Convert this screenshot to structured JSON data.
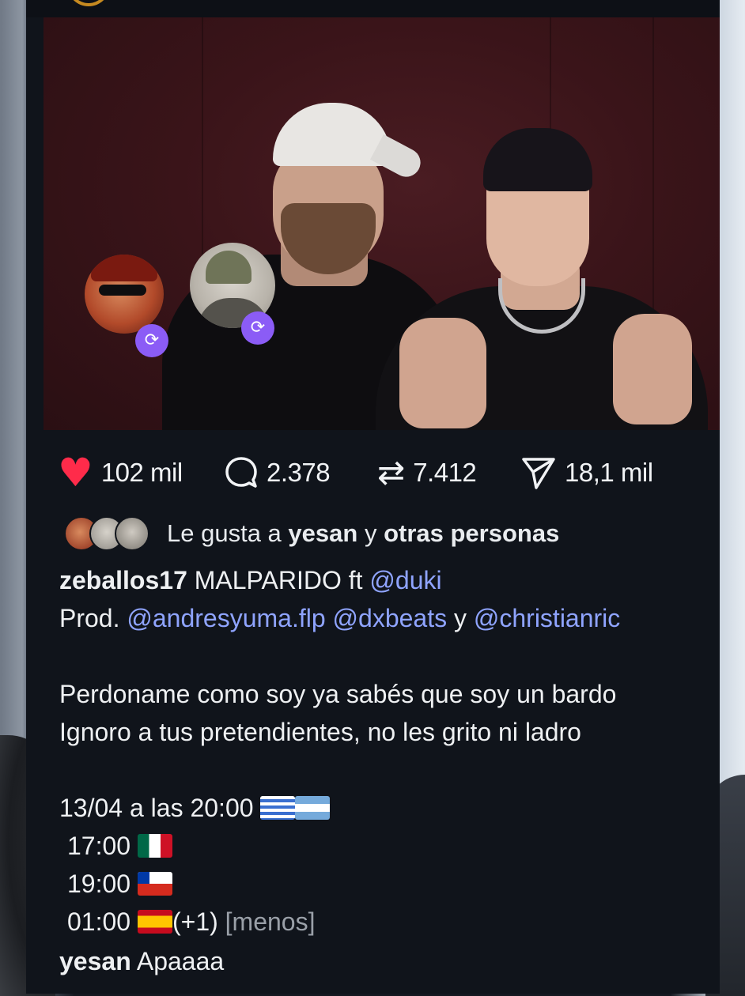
{
  "post": {
    "author": "zeballos17",
    "repost_badge_icon": "repost-icon",
    "stats": {
      "likes": "102 mil",
      "comments": "2.378",
      "reposts": "7.412",
      "shares": "18,1 mil"
    },
    "liked_by": {
      "prefix": "Le gusta a",
      "user": "yesan",
      "connector": "y",
      "others": "otras personas"
    },
    "caption": {
      "title": "MALPARIDO ft",
      "mention_duki": "@duki",
      "prod_label": "Prod.",
      "mention_andresyuma": "@andresyuma.flp",
      "mention_dxbeats": "@dxbeats",
      "and_word": "y",
      "mention_christian": "@christianric",
      "lyric_line_1": "Perdoname como soy ya sabés que soy un bardo",
      "lyric_line_2": "Ignoro a tus pretendientes, no les grito ni ladro",
      "schedule_main": "13/04 a las 20:00",
      "schedule_mx": "17:00",
      "schedule_cl": "19:00",
      "schedule_es": "01:00",
      "schedule_es_suffix": "(+1)",
      "less_link": "[menos]"
    },
    "top_comment": {
      "user": "yesan",
      "text": "Apaaaa"
    }
  },
  "colors": {
    "like": "#ff2b4a",
    "mention": "#8fa4ff",
    "repost_badge": "#8b5cf6",
    "card_bg": "#10141b"
  }
}
